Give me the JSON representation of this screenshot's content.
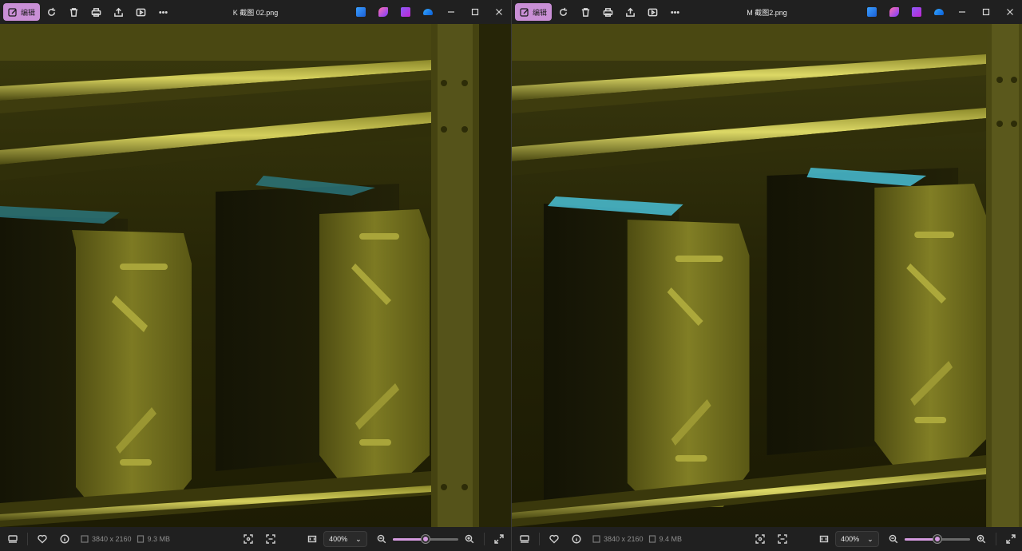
{
  "windows": [
    {
      "title": "K 截图 02.png",
      "edit_label": "编辑",
      "image_info": {
        "dimensions": "3840 x 2160",
        "file_size": "9.3 MB"
      },
      "zoom": {
        "value": "400%",
        "slider_fraction": 0.5
      }
    },
    {
      "title": "M 截图2.png",
      "edit_label": "编辑",
      "image_info": {
        "dimensions": "3840 x 2160",
        "file_size": "9.4 MB"
      },
      "zoom": {
        "value": "400%",
        "slider_fraction": 0.5
      }
    }
  ],
  "icons": {
    "toolbar": [
      "rotate-icon",
      "delete-icon",
      "print-icon",
      "share-icon",
      "slideshow-icon",
      "more-icon"
    ],
    "apps": [
      "clipchamp-icon",
      "designer-icon",
      "copilot-icon",
      "onedrive-icon"
    ],
    "window_controls": [
      "minimize-icon",
      "maximize-icon",
      "close-icon"
    ]
  },
  "colors": {
    "accent": "#c98fd6",
    "slider_accent": "#d59be0",
    "titlebar_bg": "#202020",
    "scene_tint": "#5e5d15"
  }
}
